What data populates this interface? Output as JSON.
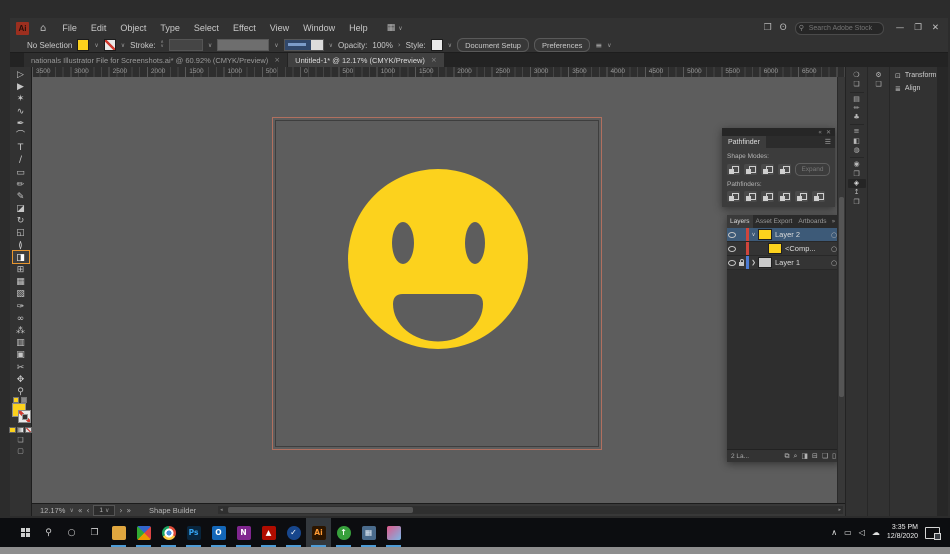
{
  "menubar": {
    "logo_text": "Ai",
    "home_glyph": "⌂",
    "menus": [
      "File",
      "Edit",
      "Object",
      "Type",
      "Select",
      "Effect",
      "View",
      "Window",
      "Help"
    ],
    "workspace_glyph": "▦",
    "arrange_glyph": "❒",
    "bulb_glyph": "ʘ",
    "search_icon_glyph": "⚲",
    "search_placeholder": "Search Adobe Stock",
    "window_controls": [
      {
        "name": "minimize",
        "glyph": "—"
      },
      {
        "name": "restore",
        "glyph": "❐"
      },
      {
        "name": "close",
        "glyph": "✕"
      }
    ]
  },
  "controlbar": {
    "selection_status": "No Selection",
    "stroke_label": "Stroke:",
    "opacity_label": "Opacity:",
    "opacity_value": "100%",
    "opacity_more": "›",
    "style_label": "Style:",
    "document_setup_label": "Document Setup",
    "preferences_label": "Preferences",
    "align_glyph": "≡"
  },
  "tabs": [
    {
      "label": "nationals Illustrator File for Screenshots.ai* @ 60.92% (CMYK/Preview)",
      "active": false
    },
    {
      "label": "Untitled-1* @ 12.17% (CMYK/Preview)",
      "active": true
    }
  ],
  "toolbar": {
    "tools": [
      {
        "name": "selection-tool",
        "glyph": "▷"
      },
      {
        "name": "direct-selection-tool",
        "glyph": "▶"
      },
      {
        "name": "magic-wand-tool",
        "glyph": "✶"
      },
      {
        "name": "lasso-tool",
        "glyph": "∿"
      },
      {
        "name": "pen-tool",
        "glyph": "✒"
      },
      {
        "name": "curvature-tool",
        "glyph": "⌒"
      },
      {
        "name": "type-tool",
        "glyph": "T"
      },
      {
        "name": "line-segment-tool",
        "glyph": "∕"
      },
      {
        "name": "rectangle-tool",
        "glyph": "▭"
      },
      {
        "name": "paintbrush-tool",
        "glyph": "✏"
      },
      {
        "name": "shaper-tool",
        "glyph": "✎"
      },
      {
        "name": "eraser-tool",
        "glyph": "◪"
      },
      {
        "name": "rotate-tool",
        "glyph": "↻"
      },
      {
        "name": "scale-tool",
        "glyph": "◱"
      },
      {
        "name": "width-tool",
        "glyph": "≬"
      },
      {
        "name": "shape-builder-tool",
        "glyph": "◨",
        "selected": true
      },
      {
        "name": "perspective-grid-tool",
        "glyph": "⊞"
      },
      {
        "name": "mesh-tool",
        "glyph": "▦"
      },
      {
        "name": "gradient-tool",
        "glyph": "▧"
      },
      {
        "name": "eyedropper-tool",
        "glyph": "✑"
      },
      {
        "name": "blend-tool",
        "glyph": "∞"
      },
      {
        "name": "symbol-sprayer-tool",
        "glyph": "⁂"
      },
      {
        "name": "column-graph-tool",
        "glyph": "▥"
      },
      {
        "name": "artboard-tool",
        "glyph": "▣"
      },
      {
        "name": "slice-tool",
        "glyph": "✂"
      },
      {
        "name": "hand-tool",
        "glyph": "✥"
      },
      {
        "name": "zoom-tool",
        "glyph": "⚲"
      }
    ]
  },
  "ruler": {
    "labels": [
      "3500",
      "3000",
      "2500",
      "2000",
      "1500",
      "1000",
      "500",
      "0",
      "500",
      "1000",
      "1500",
      "2000",
      "2500",
      "3000",
      "3500",
      "4000",
      "4500",
      "5000",
      "5500",
      "6000",
      "6500"
    ]
  },
  "canvas": {
    "background": "#5d5d5d",
    "artboard_border": "#b1705f",
    "smiley_color": "#fcd21d",
    "feature_color": "#5d5d5d"
  },
  "pathfinder": {
    "title": "Pathfinder",
    "titlebar_icons": [
      {
        "name": "collapse",
        "glyph": "«"
      },
      {
        "name": "close",
        "glyph": "✕"
      }
    ],
    "menu_glyph": "☰",
    "shape_modes_label": "Shape Modes:",
    "shape_modes": [
      {
        "name": "unite"
      },
      {
        "name": "minus-front"
      },
      {
        "name": "intersect"
      },
      {
        "name": "exclude"
      }
    ],
    "expand_label": "Expand",
    "pathfinders_label": "Pathfinders:",
    "pathfinders": [
      {
        "name": "divide"
      },
      {
        "name": "trim"
      },
      {
        "name": "merge"
      },
      {
        "name": "crop"
      },
      {
        "name": "outline"
      },
      {
        "name": "minus-back"
      }
    ]
  },
  "layers": {
    "tabs": [
      {
        "label": "Layers",
        "active": true
      },
      {
        "label": "Asset Export",
        "active": false
      },
      {
        "label": "Artboards",
        "active": false
      }
    ],
    "header_icons": [
      {
        "name": "collapse",
        "glyph": "»"
      },
      {
        "name": "panel-menu",
        "glyph": "☰"
      }
    ],
    "rows": [
      {
        "label": "Layer 2",
        "selected": true,
        "color": "#d0453c",
        "thumb": "#fcd21d",
        "disclosure": "∨",
        "locked": false,
        "indent": 0,
        "target": "○"
      },
      {
        "label": "<Comp...",
        "selected": false,
        "color": "#d0453c",
        "thumb": "#fcd21d",
        "disclosure": "",
        "locked": false,
        "indent": 1,
        "target": "○"
      },
      {
        "label": "Layer 1",
        "selected": false,
        "color": "#4d7bd2",
        "thumb": "#c9c9c9",
        "disclosure": "❯",
        "locked": true,
        "indent": 0,
        "target": "○"
      }
    ],
    "status_text": "2 La...",
    "footer_icons": [
      {
        "name": "collect-for-export",
        "glyph": "⧉"
      },
      {
        "name": "locate-object",
        "glyph": "⌕"
      },
      {
        "name": "make-clip-mask",
        "glyph": "◨"
      },
      {
        "name": "new-sublayer",
        "glyph": "⊟"
      },
      {
        "name": "new-layer",
        "glyph": "❏"
      },
      {
        "name": "delete-selection",
        "glyph": "▯"
      }
    ]
  },
  "right_dock": {
    "strip1": [
      {
        "name": "cc-libraries",
        "glyph": "❍"
      },
      {
        "name": "color",
        "glyph": "❏"
      },
      {
        "name": "swatches",
        "glyph": "▤"
      },
      {
        "name": "brushes",
        "glyph": "✏"
      },
      {
        "name": "symbols",
        "glyph": "♣"
      },
      {
        "name": "stroke",
        "glyph": "≡"
      },
      {
        "name": "gradient",
        "glyph": "◧"
      },
      {
        "name": "transparency",
        "glyph": "◍"
      },
      {
        "name": "appearance",
        "glyph": "◉"
      },
      {
        "name": "graphic-styles",
        "glyph": "❒"
      },
      {
        "name": "layers",
        "glyph": "◈",
        "active": true
      },
      {
        "name": "asset-export",
        "glyph": "↥"
      },
      {
        "name": "artboards",
        "glyph": "❐"
      }
    ],
    "strip2": [
      {
        "name": "properties",
        "glyph": "⚙"
      },
      {
        "name": "libraries",
        "glyph": "❑"
      }
    ],
    "expanded": [
      {
        "name": "transform",
        "label": "Transform",
        "glyph": "⊡"
      },
      {
        "name": "align",
        "label": "Align",
        "glyph": "≣"
      }
    ]
  },
  "statusbar": {
    "zoom": "12.17%",
    "caret": "∨",
    "nav": {
      "first": "«",
      "prev": "‹",
      "next": "›",
      "last": "»"
    },
    "artboard": "1",
    "tool": "Shape Builder"
  },
  "taskbar": {
    "items": [
      {
        "name": "start",
        "kind": "start"
      },
      {
        "name": "search",
        "kind": "glyph",
        "glyph": "⚲"
      },
      {
        "name": "cortana",
        "kind": "glyph",
        "glyph": "○"
      },
      {
        "name": "task-view",
        "kind": "glyph",
        "glyph": "❐"
      },
      {
        "name": "file-explorer",
        "kind": "tile",
        "bg": "#dfa63f",
        "fg": "#8a6218",
        "text": "",
        "running": true
      },
      {
        "name": "photos",
        "kind": "tile",
        "style": "photos",
        "text": "",
        "running": true
      },
      {
        "name": "chrome",
        "kind": "circle",
        "style": "chrome",
        "text": "",
        "running": true
      },
      {
        "name": "photoshop",
        "kind": "tile",
        "bg": "#08253d",
        "fg": "#35a4f2",
        "text": "Ps",
        "running": true
      },
      {
        "name": "outlook",
        "kind": "tile",
        "bg": "#1467b8",
        "fg": "#ffffff",
        "text": "O",
        "running": true
      },
      {
        "name": "onenote",
        "kind": "tile",
        "bg": "#80268f",
        "fg": "#ffffff",
        "text": "N",
        "running": true
      },
      {
        "name": "acrobat",
        "kind": "tile",
        "bg": "#b00c00",
        "fg": "#ffffff",
        "text": "▲",
        "running": true
      },
      {
        "name": "todo-check",
        "kind": "circle",
        "bg": "#17468c",
        "fg": "#ffffff",
        "text": "✓",
        "running": true
      },
      {
        "name": "illustrator",
        "kind": "tile",
        "bg": "#2b1500",
        "fg": "#ff9a33",
        "text": "Ai",
        "running": true,
        "active": true
      },
      {
        "name": "green-app",
        "kind": "circle",
        "bg": "#37a03c",
        "fg": "#ffffff",
        "text": "↑",
        "running": true
      },
      {
        "name": "calculator",
        "kind": "tile",
        "bg": "#4a6b8c",
        "fg": "#e8f0f8",
        "text": "▦",
        "running": true
      },
      {
        "name": "paint-3d",
        "kind": "tile",
        "style": "paint",
        "text": "",
        "running": true
      }
    ],
    "tray_icons": [
      {
        "name": "hidden-icons",
        "glyph": "∧"
      },
      {
        "name": "display",
        "glyph": "▭"
      },
      {
        "name": "volume",
        "glyph": "◁"
      },
      {
        "name": "onedrive",
        "glyph": "☁"
      }
    ],
    "time": "3:35 PM",
    "date": "12/8/2020"
  }
}
